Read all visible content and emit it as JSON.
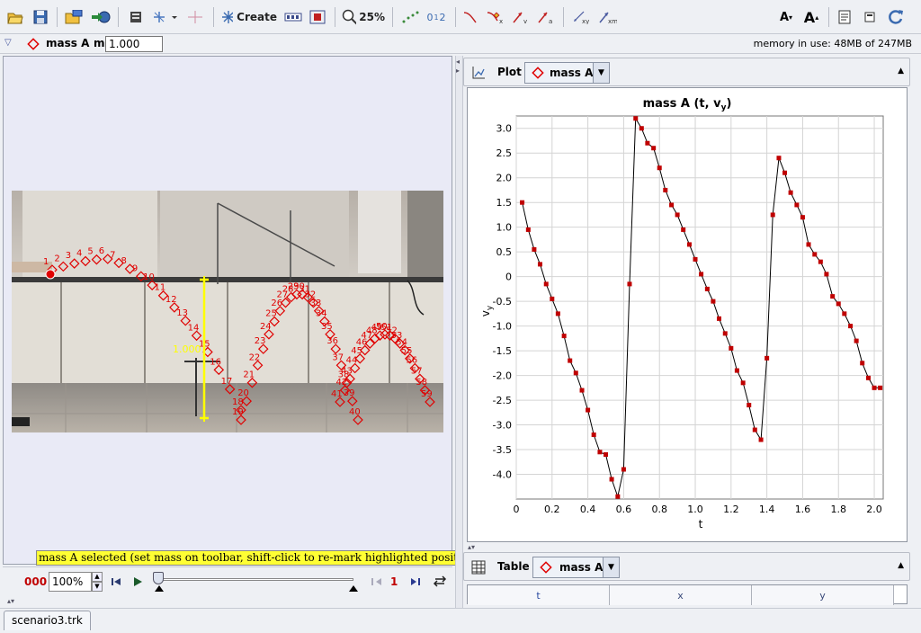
{
  "toolbar": {
    "create_label": "Create",
    "zoom_label": "25%",
    "points_label": "0",
    "points_sub": "1",
    "points_sub2": "2",
    "mem_text": "memory in use: 48MB of 247MB"
  },
  "track_bar": {
    "track_name": "mass A",
    "mass_label": "m",
    "mass_value": "1.000"
  },
  "video": {
    "tape_label": "1.000",
    "point_numbers": [
      "1",
      "2",
      "3",
      "4",
      "5",
      "6",
      "7",
      "8",
      "9",
      "10",
      "11",
      "12",
      "13",
      "14",
      "15",
      "16",
      "17",
      "18",
      "19",
      "20",
      "21",
      "22",
      "23",
      "24",
      "25",
      "26",
      "27",
      "28",
      "29",
      "30",
      "31",
      "32",
      "33",
      "34",
      "35",
      "36",
      "37",
      "38",
      "39",
      "40",
      "41",
      "42",
      "43",
      "44",
      "45",
      "46",
      "47",
      "48",
      "49",
      "50",
      "51",
      "52",
      "53",
      "54",
      "55",
      "56",
      "57",
      "58",
      "59"
    ]
  },
  "status_message": "mass A selected (set mass on toolbar, shift-click to re-mark highlighted position)",
  "player": {
    "frame_counter": "000",
    "rate": "100%",
    "step_value": "1"
  },
  "plot_panel": {
    "label": "Plot",
    "track_name": "mass A"
  },
  "table_panel": {
    "label": "Table",
    "track_name": "mass A",
    "columns": [
      "t",
      "x",
      "y"
    ]
  },
  "file_tab": "scenario3.trk",
  "colors": {
    "track_red": "#e00000",
    "tape_yellow": "#ffff00",
    "highlight": "#ffff33",
    "plot_point": "#c00000"
  },
  "chart_data": {
    "type": "line",
    "title": "mass A (t, vy)",
    "title_main": "mass A (t, v",
    "title_sub": "y",
    "title_end": ")",
    "xlabel": "t",
    "ylabel_main": "v",
    "ylabel_sub": "y",
    "xlim": [
      0,
      2.05
    ],
    "ylim": [
      -4.5,
      3.25
    ],
    "x_ticks": [
      0,
      0.2,
      0.4,
      0.6,
      0.8,
      1.0,
      1.2,
      1.4,
      1.6,
      1.8,
      2.0
    ],
    "x_tick_labels": [
      "0",
      "0.2",
      "0.4",
      "0.6",
      "0.8",
      "1.0",
      "1.2",
      "1.4",
      "1.6",
      "1.8",
      "2.0"
    ],
    "y_ticks": [
      3.0,
      2.5,
      2.0,
      1.5,
      1.0,
      0.5,
      0.0,
      -0.5,
      -1.0,
      -1.5,
      -2.0,
      -2.5,
      -3.0,
      -3.5,
      -4.0
    ],
    "y_tick_labels": [
      "3.0",
      "2.5",
      "2.0",
      "1.5",
      "1.0",
      "0.5",
      "0",
      "-0.5",
      "-1.0",
      "-1.5",
      "-2.0",
      "-2.5",
      "-3.0",
      "-3.5",
      "-4.0"
    ],
    "grid": true,
    "series": [
      {
        "x": [
          0.033,
          0.067,
          0.1,
          0.133,
          0.167,
          0.2,
          0.233,
          0.267,
          0.3,
          0.333,
          0.367,
          0.4,
          0.433,
          0.467,
          0.5,
          0.533,
          0.567,
          0.6,
          0.633,
          0.667,
          0.7,
          0.733,
          0.767,
          0.8,
          0.833,
          0.867,
          0.9,
          0.933,
          0.967,
          1.0,
          1.033,
          1.067,
          1.1,
          1.133,
          1.167,
          1.2,
          1.233,
          1.267,
          1.3,
          1.333,
          1.367,
          1.4,
          1.433,
          1.467,
          1.5,
          1.533,
          1.567,
          1.6,
          1.633,
          1.667,
          1.7,
          1.733,
          1.767,
          1.8,
          1.833,
          1.867,
          1.9,
          1.933,
          1.967,
          2.0,
          2.033
        ],
        "y": [
          1.5,
          0.95,
          0.55,
          0.25,
          -0.15,
          -0.45,
          -0.75,
          -1.2,
          -1.7,
          -1.95,
          -2.3,
          -2.7,
          -3.2,
          -3.55,
          -3.6,
          -4.1,
          -4.45,
          -3.9,
          -0.15,
          3.2,
          3.0,
          2.7,
          2.6,
          2.2,
          1.75,
          1.45,
          1.25,
          0.95,
          0.65,
          0.35,
          0.05,
          -0.25,
          -0.5,
          -0.85,
          -1.15,
          -1.45,
          -1.9,
          -2.15,
          -2.6,
          -3.1,
          -3.3,
          -1.65,
          1.25,
          2.4,
          2.1,
          1.7,
          1.45,
          1.2,
          0.65,
          0.45,
          0.3,
          0.05,
          -0.4,
          -0.55,
          -0.75,
          -1.0,
          -1.3,
          -1.75,
          -2.05,
          -2.25,
          -2.25
        ]
      }
    ]
  }
}
